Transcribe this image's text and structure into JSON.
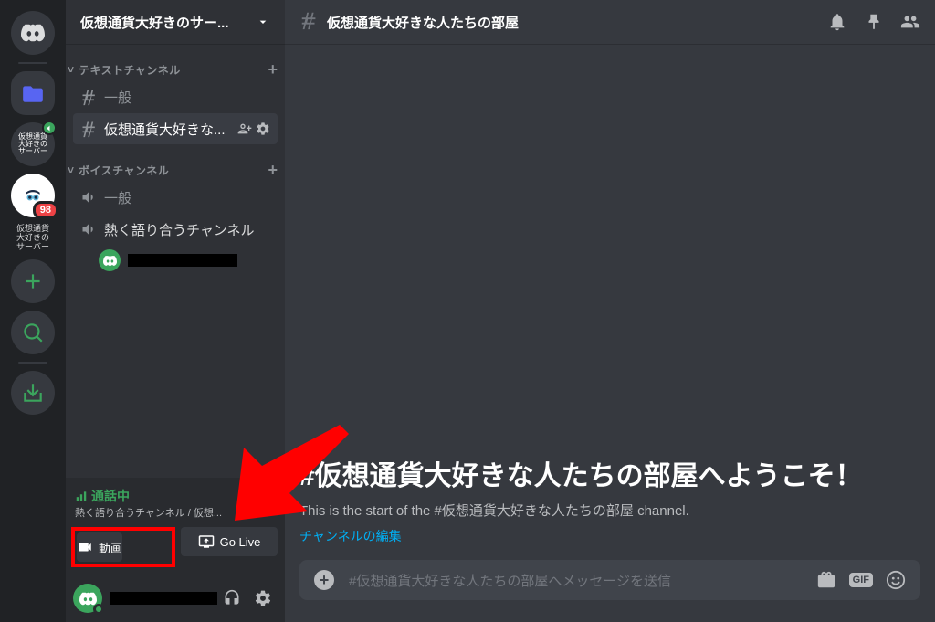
{
  "server": {
    "name": "仮想通貨大好きのサー...",
    "label1": "仮想通貨\n大好きの\nサーバー",
    "label2": "仮想通貨\n大好きの\nサーバー",
    "badge": "98"
  },
  "categories": {
    "text": "テキストチャンネル",
    "voice": "ボイスチャンネル"
  },
  "channels": {
    "general": "一般",
    "crypto": "仮想通貨大好きな...",
    "vgeneral": "一般",
    "vhot": "熱く語り合うチャンネル"
  },
  "voice": {
    "status": "通話中",
    "sub": "熱く語り合うチャンネル / 仮想...",
    "video": "動画",
    "golive": "Go Live"
  },
  "header": {
    "title": "仮想通貨大好きな人たちの部屋"
  },
  "welcome": {
    "title": "#仮想通貨大好きな人たちの部屋へようこそ！",
    "desc": "This is the start of the #仮想通貨大好きな人たちの部屋 channel.",
    "edit": "チャンネルの編集"
  },
  "input": {
    "placeholder": "#仮想通貨大好きな人たちの部屋へメッセージを送信",
    "gif": "GIF"
  }
}
